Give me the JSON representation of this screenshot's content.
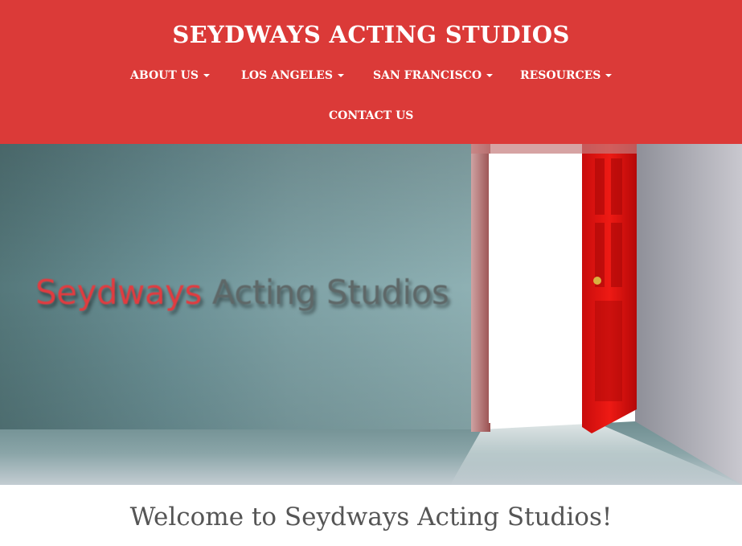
{
  "header": {
    "site_title": "SEYDWAYS ACTING STUDIOS",
    "background_color": "#db3a38",
    "nav": [
      {
        "label": "ABOUT US",
        "dropdown": true
      },
      {
        "label": "LOS ANGELES",
        "dropdown": true
      },
      {
        "label": "SAN FRANCISCO",
        "dropdown": true
      },
      {
        "label": "RESOURCES",
        "dropdown": true
      },
      {
        "label": "CONTACT US",
        "dropdown": false
      }
    ]
  },
  "hero": {
    "image_text_part1": "Seydways",
    "image_text_part2": "Acting Studios",
    "door_color": "#e01010"
  },
  "main": {
    "welcome_heading": "Welcome to Seydways Acting Studios!"
  }
}
